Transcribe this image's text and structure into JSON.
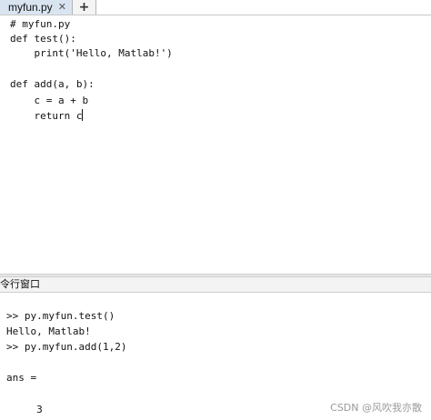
{
  "editor": {
    "tabs": [
      {
        "label": "myfun.py",
        "close": "✕"
      }
    ],
    "add_tab": "+",
    "lines": [
      "# myfun.py",
      "def test():",
      "    print('Hello, Matlab!')",
      "",
      "def add(a, b):",
      "    c = a + b",
      "    return c"
    ]
  },
  "command_window": {
    "title": "令行窗口",
    "lines": [
      ">> py.myfun.test()",
      "Hello, Matlab!",
      ">> py.myfun.add(1,2)",
      "",
      "ans =",
      "",
      "     3"
    ]
  },
  "watermark": "CSDN @风吹我亦散"
}
